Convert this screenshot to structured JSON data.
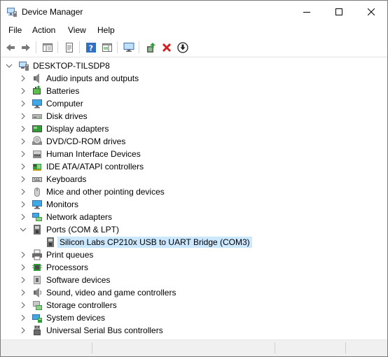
{
  "window": {
    "title": "Device Manager",
    "controls": {
      "minimize": "minimize-icon",
      "maximize": "maximize-icon",
      "close": "close-icon"
    }
  },
  "menu": {
    "file": "File",
    "action": "Action",
    "view": "View",
    "help": "Help"
  },
  "toolbar": {
    "buttons": [
      "back-arrow-icon",
      "forward-arrow-icon",
      "properties-icon",
      "driver-details-icon",
      "help-icon",
      "console-icon",
      "scan-hardware-icon",
      "update-driver-icon",
      "uninstall-device-icon",
      "disable-device-icon"
    ],
    "colors": {
      "green": "#2f9e37",
      "red": "#d32121",
      "blue": "#2f6fc4"
    }
  },
  "tree": {
    "root": "DESKTOP-TILSDP8",
    "categories": [
      {
        "label": "Audio inputs and outputs",
        "icon": "speaker-icon"
      },
      {
        "label": "Batteries",
        "icon": "battery-icon"
      },
      {
        "label": "Computer",
        "icon": "computer-icon"
      },
      {
        "label": "Disk drives",
        "icon": "disk-drive-icon"
      },
      {
        "label": "Display adapters",
        "icon": "display-adapter-icon"
      },
      {
        "label": "DVD/CD-ROM drives",
        "icon": "dvd-icon"
      },
      {
        "label": "Human Interface Devices",
        "icon": "hid-icon"
      },
      {
        "label": "IDE ATA/ATAPI controllers",
        "icon": "ide-controller-icon"
      },
      {
        "label": "Keyboards",
        "icon": "keyboard-icon"
      },
      {
        "label": "Mice and other pointing devices",
        "icon": "mouse-icon"
      },
      {
        "label": "Monitors",
        "icon": "monitor-icon"
      },
      {
        "label": "Network adapters",
        "icon": "network-adapter-icon"
      },
      {
        "label": "Ports (COM & LPT)",
        "icon": "port-icon",
        "expanded": true
      },
      {
        "label": "Silicon Labs CP210x USB to UART Bridge (COM3)",
        "icon": "port-device-icon",
        "child": true,
        "selected": true
      },
      {
        "label": "Print queues",
        "icon": "printer-icon"
      },
      {
        "label": "Processors",
        "icon": "processor-icon"
      },
      {
        "label": "Software devices",
        "icon": "software-device-icon"
      },
      {
        "label": "Sound, video and game controllers",
        "icon": "sound-icon"
      },
      {
        "label": "Storage controllers",
        "icon": "storage-controller-icon"
      },
      {
        "label": "System devices",
        "icon": "system-devices-icon"
      },
      {
        "label": "Universal Serial Bus controllers",
        "icon": "usb-icon"
      }
    ]
  },
  "colors": {
    "selection": "#cce8ff",
    "chevron": "#6d6d6d"
  }
}
